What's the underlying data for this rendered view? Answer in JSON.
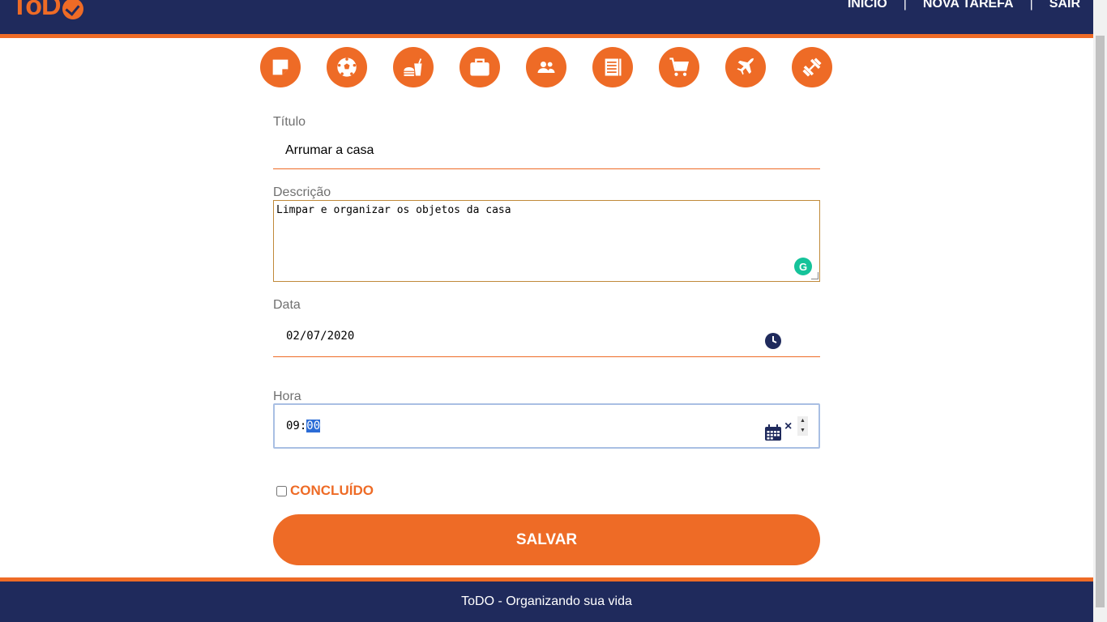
{
  "header": {
    "logo_text": "ToD",
    "nav": {
      "inicio": "INÍCIO",
      "separator": "|",
      "nova_tarefa": "NOVA TAREFA",
      "sair": "SAIR"
    }
  },
  "categories": [
    {
      "icon": "note-icon"
    },
    {
      "icon": "soccer-ball-icon"
    },
    {
      "icon": "food-icon"
    },
    {
      "icon": "briefcase-icon"
    },
    {
      "icon": "people-icon"
    },
    {
      "icon": "book-icon"
    },
    {
      "icon": "shopping-cart-icon"
    },
    {
      "icon": "airplane-icon"
    },
    {
      "icon": "dumbbell-icon"
    }
  ],
  "form": {
    "titulo_label": "Título",
    "titulo_value": "Arrumar a casa",
    "descricao_label": "Descrição",
    "descricao_value": "Limpar e organizar os objetos da casa",
    "data_label": "Data",
    "data_value": "02/07/2020",
    "hora_label": "Hora",
    "hora_hours": "09",
    "hora_separator": ":",
    "hora_minutes": "00",
    "concluido_label": "CONCLUÍDO",
    "save_label": "SALVAR"
  },
  "footer": {
    "text": "ToDO - Organizando sua vida"
  },
  "colors": {
    "primary": "#ee6b26",
    "navy": "#1f2a5c"
  }
}
